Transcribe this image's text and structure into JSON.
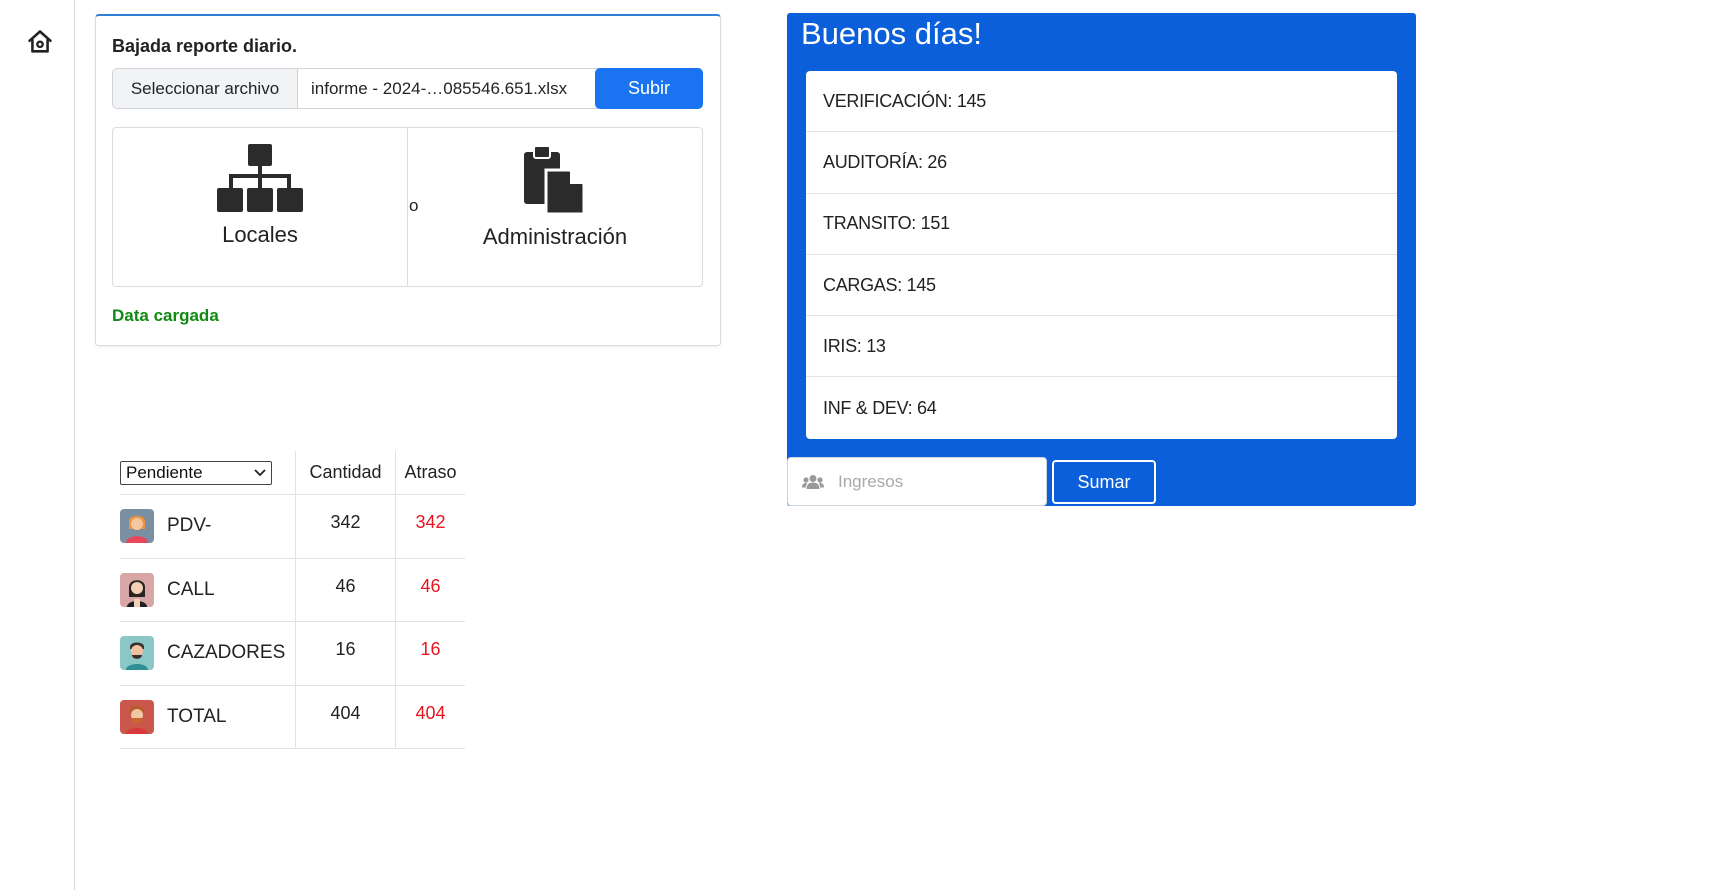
{
  "upload": {
    "title": "Bajada reporte diario.",
    "choose_label": "Seleccionar archivo",
    "file_name": "informe - 2024-…085546.651.xlsx",
    "submit_label": "Subir",
    "option_locales": "Locales",
    "option_or": "o",
    "option_admin": "Administración",
    "status": "Data cargada"
  },
  "greeting": {
    "title": "Buenos días!",
    "stats": [
      "VERIFICACIÓN: 145",
      "AUDITORÍA: 26",
      "TRANSITO: 151",
      "CARGAS: 145",
      "IRIS: 13",
      "INF & DEV: 64"
    ],
    "input_placeholder": "Ingresos",
    "sum_label": "Sumar"
  },
  "table": {
    "filter_value": "Pendiente",
    "col_cantidad": "Cantidad",
    "col_atraso": "Atraso",
    "rows": [
      {
        "label": "PDV-",
        "cantidad": "342",
        "atraso": "342"
      },
      {
        "label": "CALL",
        "cantidad": "46",
        "atraso": "46"
      },
      {
        "label": "CAZADORES",
        "cantidad": "16",
        "atraso": "16"
      },
      {
        "label": "TOTAL",
        "cantidad": "404",
        "atraso": "404"
      }
    ]
  },
  "colors": {
    "primary": "#1a73f0",
    "panel_blue": "#0c5fdb",
    "status_green": "#138a13",
    "atraso_red": "#e8141e"
  },
  "icons": [
    "home-icon",
    "sitemap-icon",
    "paste-icon",
    "users-icon",
    "chevron-down-icon"
  ]
}
